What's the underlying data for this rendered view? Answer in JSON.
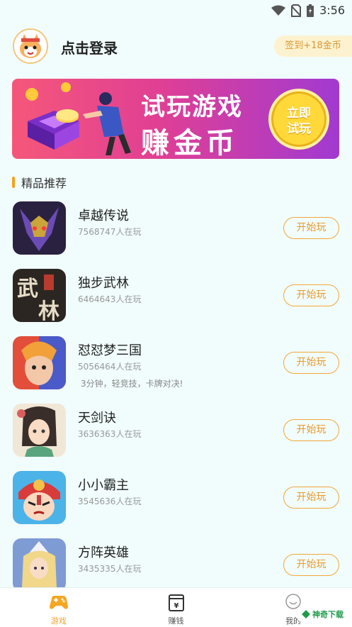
{
  "status": {
    "time": "3:56"
  },
  "header": {
    "login_label": "点击登录",
    "checkin_label": "签到+18金币"
  },
  "banner": {
    "line1": "试玩游戏",
    "line2": "赚金币",
    "coin_text": "立即\n试玩"
  },
  "section": {
    "title": "精品推荐"
  },
  "games": [
    {
      "name": "卓越传说",
      "players": "7568747人在玩",
      "desc": "",
      "button": "开始玩",
      "icon": "dark-knight-icon",
      "color": "#3b2f63"
    },
    {
      "name": "独步武林",
      "players": "6464643人在玩",
      "desc": "",
      "button": "开始玩",
      "icon": "wulin-calligraphy-icon",
      "color": "#2b2621"
    },
    {
      "name": "怼怼梦三国",
      "players": "5056464人在玩",
      "desc": "3分钟，轻竞技，卡牌对决!",
      "button": "开始玩",
      "icon": "three-kingdoms-hero-icon",
      "color": "#d9503e"
    },
    {
      "name": "天剑诀",
      "players": "3636363人在玩",
      "desc": "",
      "button": "开始玩",
      "icon": "swordswoman-icon",
      "color": "#efe4d2"
    },
    {
      "name": "小小霸主",
      "players": "3545636人在玩",
      "desc": "",
      "button": "开始玩",
      "icon": "opera-warrior-icon",
      "color": "#d93b3b"
    },
    {
      "name": "方阵英雄",
      "players": "3435335人在玩",
      "desc": "",
      "button": "开始玩",
      "icon": "paladin-hero-icon",
      "color": "#8aa7d8"
    }
  ],
  "nav": [
    {
      "label": "游戏",
      "icon": "gamepad-icon",
      "active": true
    },
    {
      "label": "赚钱",
      "icon": "wallet-icon",
      "active": false
    },
    {
      "label": "我的",
      "icon": "smiley-icon",
      "active": false
    }
  ],
  "watermark": {
    "text": "神奇下载"
  },
  "colors": {
    "accent": "#f2a12a",
    "background": "#f1fcfc",
    "button_border": "#f3a73b"
  }
}
